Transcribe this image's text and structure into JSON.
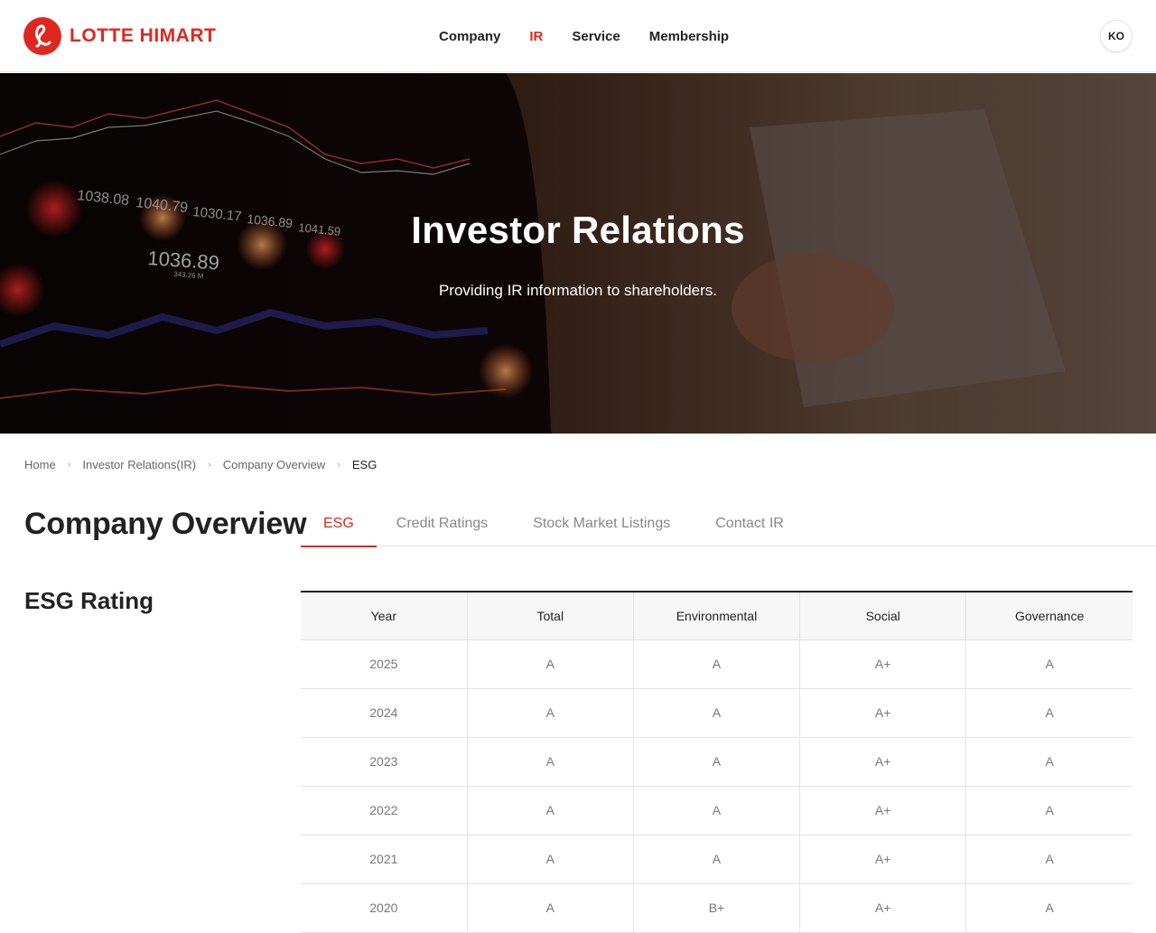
{
  "header": {
    "logo_text": "LOTTE HIMART",
    "nav": [
      {
        "label": "Company",
        "active": false
      },
      {
        "label": "IR",
        "active": true
      },
      {
        "label": "Service",
        "active": false
      },
      {
        "label": "Membership",
        "active": false
      }
    ],
    "lang_button": "KO"
  },
  "hero": {
    "title": "Investor Relations",
    "subtitle": "Providing IR information to shareholders.",
    "ticker_labels": [
      "1038.08",
      "1040.79",
      "1030.17",
      "1036.89",
      "1041.59",
      "1036.89",
      "343.26 M"
    ]
  },
  "breadcrumb": [
    "Home",
    "Investor Relations(IR)",
    "Company Overview",
    "ESG"
  ],
  "page": {
    "title": "Company Overview",
    "tabs": [
      {
        "label": "ESG",
        "active": true
      },
      {
        "label": "Credit Ratings",
        "active": false
      },
      {
        "label": "Stock Market Listings",
        "active": false
      },
      {
        "label": "Contact IR",
        "active": false
      }
    ],
    "section_title": "ESG Rating"
  },
  "esg_table": {
    "columns": [
      "Year",
      "Total",
      "Environmental",
      "Social",
      "Governance"
    ],
    "rows": [
      [
        "2025",
        "A",
        "A",
        "A+",
        "A"
      ],
      [
        "2024",
        "A",
        "A",
        "A+",
        "A"
      ],
      [
        "2023",
        "A",
        "A",
        "A+",
        "A"
      ],
      [
        "2022",
        "A",
        "A",
        "A+",
        "A"
      ],
      [
        "2021",
        "A",
        "A",
        "A+",
        "A"
      ],
      [
        "2020",
        "A",
        "B+",
        "A+",
        "A"
      ]
    ]
  },
  "colors": {
    "brand_red": "#e0271f",
    "text_dark": "#222222",
    "text_muted": "#777777"
  }
}
